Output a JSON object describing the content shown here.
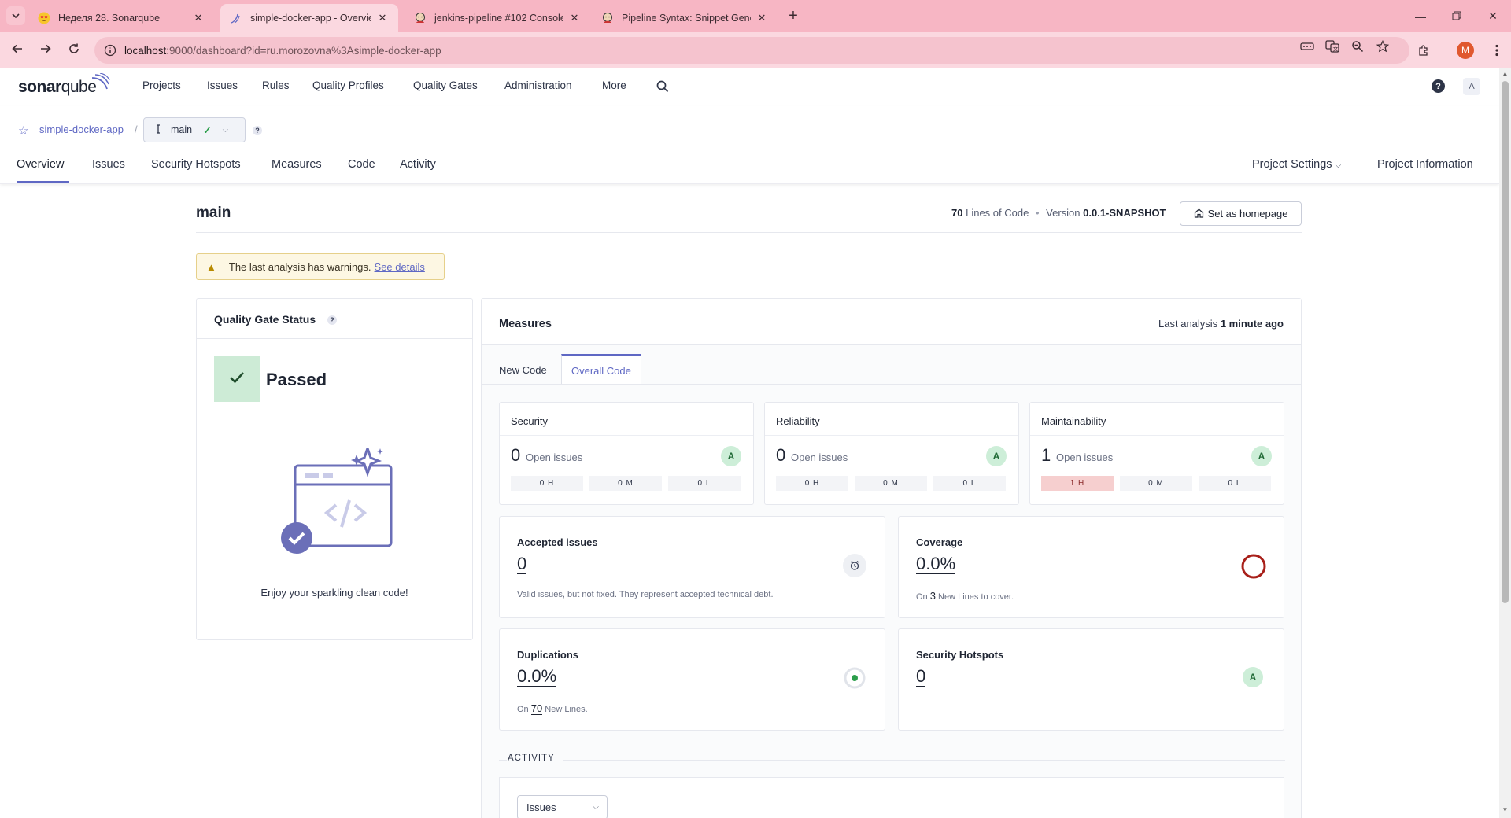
{
  "browser": {
    "tabs": [
      {
        "title": "Неделя 28. Sonarqube",
        "favicon": "heart-eyes-emoji-icon"
      },
      {
        "title": "simple-docker-app - Overview",
        "favicon": "sonarqube-icon",
        "active": true
      },
      {
        "title": "jenkins-pipeline #102 Console",
        "favicon": "jenkins-icon"
      },
      {
        "title": "Pipeline Syntax: Snippet Genera",
        "favicon": "jenkins-icon"
      }
    ],
    "url_host": "localhost",
    "url_path": ":9000/dashboard?id=ru.morozovna%3Asimple-docker-app",
    "profile_initial": "M",
    "theme_color": "#f7b6c4"
  },
  "sonar": {
    "logo_a": "sonar",
    "logo_b": "qube",
    "nav": [
      "Projects",
      "Issues",
      "Rules",
      "Quality Profiles",
      "Quality Gates",
      "Administration",
      "More"
    ],
    "help": "?",
    "avatar": "A",
    "accent": "#5f68c4"
  },
  "project": {
    "name": "simple-docker-app",
    "sep": "/",
    "branch": "main",
    "branch_help": "?",
    "tabs": [
      "Overview",
      "Issues",
      "Security Hotspots",
      "Measures",
      "Code",
      "Activity"
    ],
    "settings": "Project Settings",
    "info": "Project Information"
  },
  "main": {
    "title": "main",
    "loc_value": "70",
    "loc_label": "Lines of Code",
    "dot": "•",
    "version_label": "Version",
    "version_value": "0.0.1-SNAPSHOT",
    "homepage": "Set as homepage",
    "warning_text": "The last analysis has warnings.",
    "warning_link": "See details"
  },
  "quality_gate": {
    "title": "Quality Gate Status",
    "help": "?",
    "status": "Passed",
    "status_color": "#cdebd6",
    "message": "Enjoy your sparkling clean code!"
  },
  "measures": {
    "title": "Measures",
    "last_label": "Last analysis",
    "last_value": "1 minute ago",
    "tabs": [
      "New Code",
      "Overall Code"
    ],
    "active_tab": "Overall Code",
    "ratings": [
      {
        "title": "Security",
        "count": "0",
        "label": "Open issues",
        "grade": "A",
        "sev": [
          "0 H",
          "0 M",
          "0 L"
        ]
      },
      {
        "title": "Reliability",
        "count": "0",
        "label": "Open issues",
        "grade": "A",
        "sev": [
          "0 H",
          "0 M",
          "0 L"
        ]
      },
      {
        "title": "Maintainability",
        "count": "1",
        "label": "Open issues",
        "grade": "A",
        "sev": [
          "1 H",
          "0 M",
          "0 L"
        ]
      }
    ],
    "accepted": {
      "title": "Accepted issues",
      "value": "0",
      "sub": "Valid issues, but not fixed. They represent accepted technical debt."
    },
    "coverage": {
      "title": "Coverage",
      "value": "0.0%",
      "sub_on": "On",
      "sub_num": "3",
      "sub_rest": "New Lines to cover."
    },
    "duplications": {
      "title": "Duplications",
      "value": "0.0%",
      "sub_on": "On",
      "sub_num": "70",
      "sub_rest": "New Lines."
    },
    "hotspots": {
      "title": "Security Hotspots",
      "value": "0",
      "grade": "A"
    }
  },
  "activity": {
    "label": "ACTIVITY",
    "select": "Issues"
  }
}
